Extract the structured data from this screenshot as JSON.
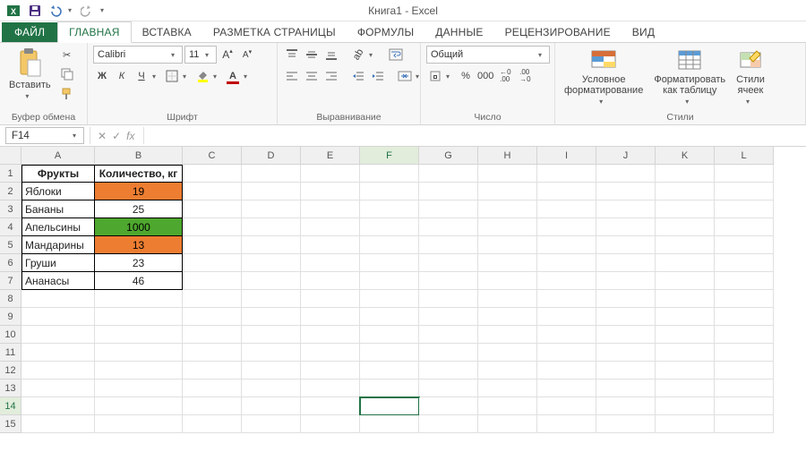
{
  "app": {
    "title": "Книга1 - Excel"
  },
  "qat": {
    "save": "Сохранить",
    "undo": "Отменить",
    "redo": "Вернуть"
  },
  "tabs": {
    "file": "ФАЙЛ",
    "items": [
      "ГЛАВНАЯ",
      "ВСТАВКА",
      "РАЗМЕТКА СТРАНИЦЫ",
      "ФОРМУЛЫ",
      "ДАННЫЕ",
      "РЕЦЕНЗИРОВАНИЕ",
      "ВИД"
    ],
    "active_index": 0
  },
  "ribbon": {
    "clipboard": {
      "label": "Буфер обмена",
      "paste": "Вставить"
    },
    "font": {
      "label": "Шрифт",
      "name": "Calibri",
      "size": "11",
      "bold": "Ж",
      "italic": "К",
      "underline": "Ч"
    },
    "alignment": {
      "label": "Выравнивание"
    },
    "number": {
      "label": "Число",
      "format": "Общий",
      "percent": "%",
      "thousands": "000",
      "inc": "←0\n.00",
      "dec": ".00\n→0"
    },
    "styles": {
      "label": "Стили",
      "cond": "Условное\nформатирование",
      "table": "Форматировать\nкак таблицу",
      "cell": "Стили\nячеек"
    }
  },
  "formula_bar": {
    "cell_ref": "F14",
    "formula": ""
  },
  "sheet": {
    "columns": [
      "A",
      "B",
      "C",
      "D",
      "E",
      "F",
      "G",
      "H",
      "I",
      "J",
      "K",
      "L"
    ],
    "row_count": 15,
    "active": {
      "col": "F",
      "row": 14
    },
    "table": {
      "header_row": 1,
      "headers": [
        "Фрукты",
        "Количество, кг"
      ],
      "rows": [
        {
          "r": 2,
          "name": "Яблоки",
          "qty": "19",
          "fill": "#ed7d31"
        },
        {
          "r": 3,
          "name": "Бананы",
          "qty": "25",
          "fill": ""
        },
        {
          "r": 4,
          "name": "Апельсины",
          "qty": "1000",
          "fill": "#4ea72e"
        },
        {
          "r": 5,
          "name": "Мандарины",
          "qty": "13",
          "fill": "#ed7d31"
        },
        {
          "r": 6,
          "name": "Груши",
          "qty": "23",
          "fill": ""
        },
        {
          "r": 7,
          "name": "Ананасы",
          "qty": "46",
          "fill": ""
        }
      ]
    }
  },
  "chart_data": {
    "type": "table",
    "title": "Фрукты — Количество, кг",
    "columns": [
      "Фрукты",
      "Количество, кг"
    ],
    "rows": [
      [
        "Яблоки",
        19
      ],
      [
        "Бананы",
        25
      ],
      [
        "Апельсины",
        1000
      ],
      [
        "Мандарины",
        13
      ],
      [
        "Груши",
        23
      ],
      [
        "Ананасы",
        46
      ]
    ]
  }
}
